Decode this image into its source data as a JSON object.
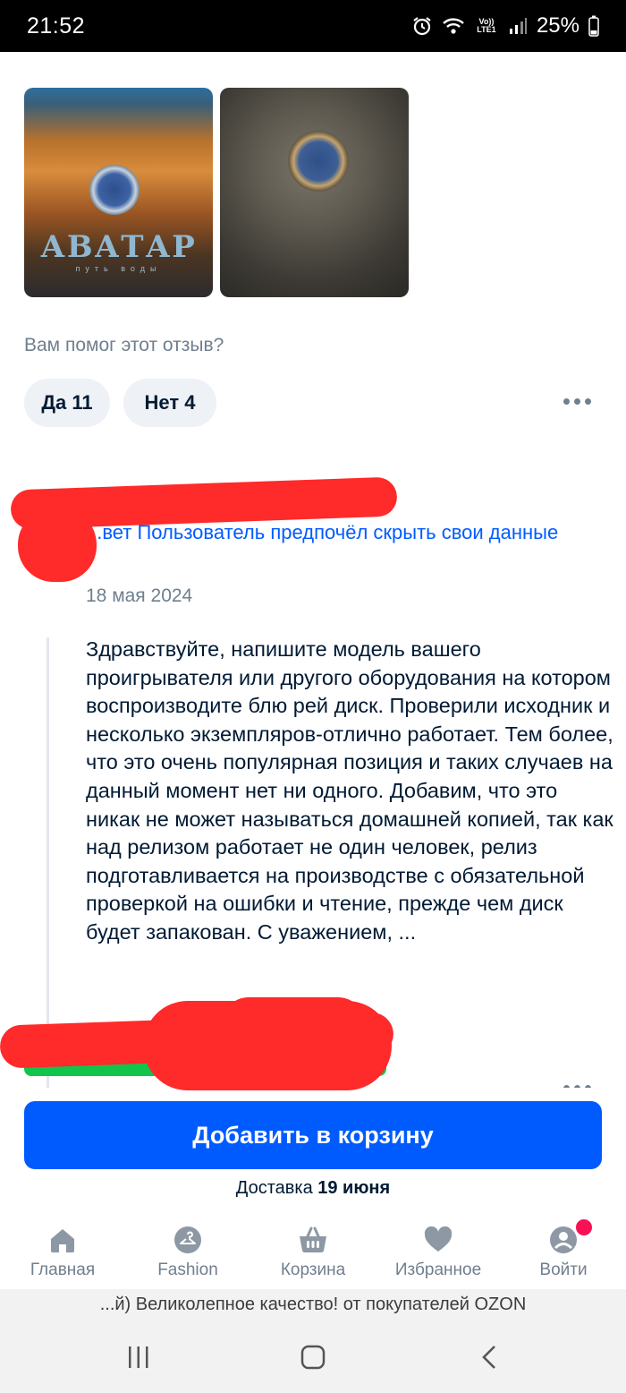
{
  "status_bar": {
    "time": "21:52",
    "network": "Vo)) LTE1",
    "battery": "25%"
  },
  "review": {
    "photos": [
      {
        "alt": "avatar-bluray-cover",
        "logo_text": "АВАТАР",
        "logo_sub": "путь воды"
      },
      {
        "alt": "disc-photo"
      }
    ],
    "helpful_question": "Вам помог этот отзыв?",
    "yes_label": "Да 11",
    "no_label": "Нет 4"
  },
  "seller_reply": {
    "author": "...вет Пользователь предпочёл скрыть свои данные",
    "date": "18 мая 2024",
    "text": "Здравствуйте, напишите модель вашего проигрывателя или другого оборудования на котором воспроизводите блю рей диск. Проверили исходник и несколько экземпляров-отлично работает. Тем более, что это очень популярная позиция и таких случаев на данный момент нет ни одного. Добавим, что это никак не может называться домашней копией, так как над релизом работает не один человек, релиз подготавливается на производстве с обязательной проверкой на ошибки и чтение, прежде чем диск будет запакован. С уважением, ..."
  },
  "cart": {
    "button_label": "Добавить в корзину",
    "delivery_prefix": "Доставка",
    "delivery_date": "19 июня"
  },
  "nav": {
    "items": [
      {
        "label": "Главная",
        "icon": "home-icon"
      },
      {
        "label": "Fashion",
        "icon": "hanger-icon"
      },
      {
        "label": "Корзина",
        "icon": "basket-icon"
      },
      {
        "label": "Избранное",
        "icon": "heart-icon"
      },
      {
        "label": "Войти",
        "icon": "profile-icon"
      }
    ]
  },
  "footer": {
    "banner": "...й) Великолепное качество! от покупателей OZON"
  },
  "colors": {
    "accent": "#005bff",
    "muted": "#707f8d",
    "text": "#001a34",
    "badge": "#f91155"
  }
}
